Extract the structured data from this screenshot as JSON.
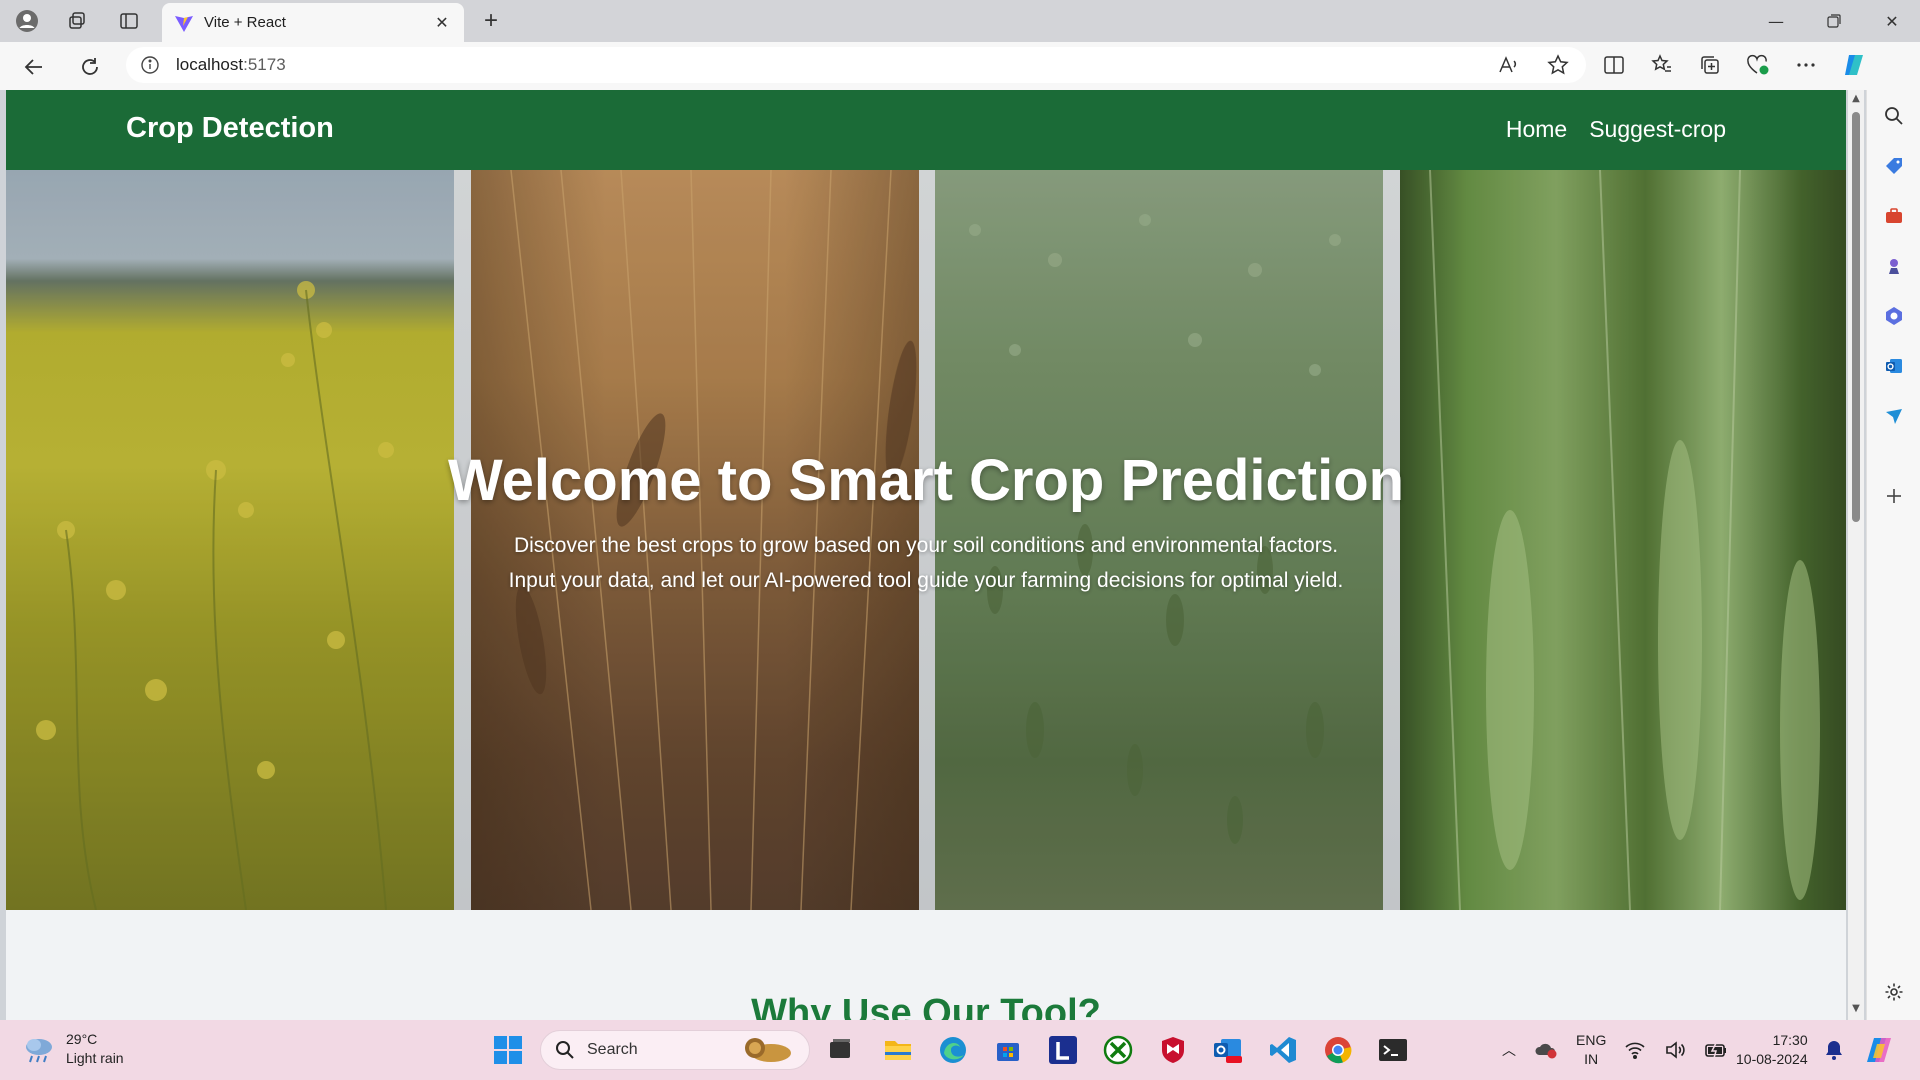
{
  "browser": {
    "tab_title": "Vite + React",
    "url_host": "localhost",
    "url_port": ":5173"
  },
  "page": {
    "brand": "Crop Detection",
    "nav": [
      {
        "label": "Home"
      },
      {
        "label": "Suggest-crop"
      }
    ],
    "hero": {
      "title": "Welcome to Smart Crop Prediction",
      "description": "Discover the best crops to grow based on your soil conditions and environmental factors. Input your data, and let our AI-powered tool guide your farming decisions for optimal yield."
    },
    "section_title": "Why Use Our Tool?"
  },
  "taskbar": {
    "weather_temp": "29°C",
    "weather_desc": "Light rain",
    "search_placeholder": "Search",
    "lang_line1": "ENG",
    "lang_line2": "IN",
    "time": "17:30",
    "date": "10-08-2024"
  },
  "colors": {
    "navbar": "#1b6b37",
    "section_title": "#1b7a3a",
    "taskbar": "#f2d9e4"
  }
}
